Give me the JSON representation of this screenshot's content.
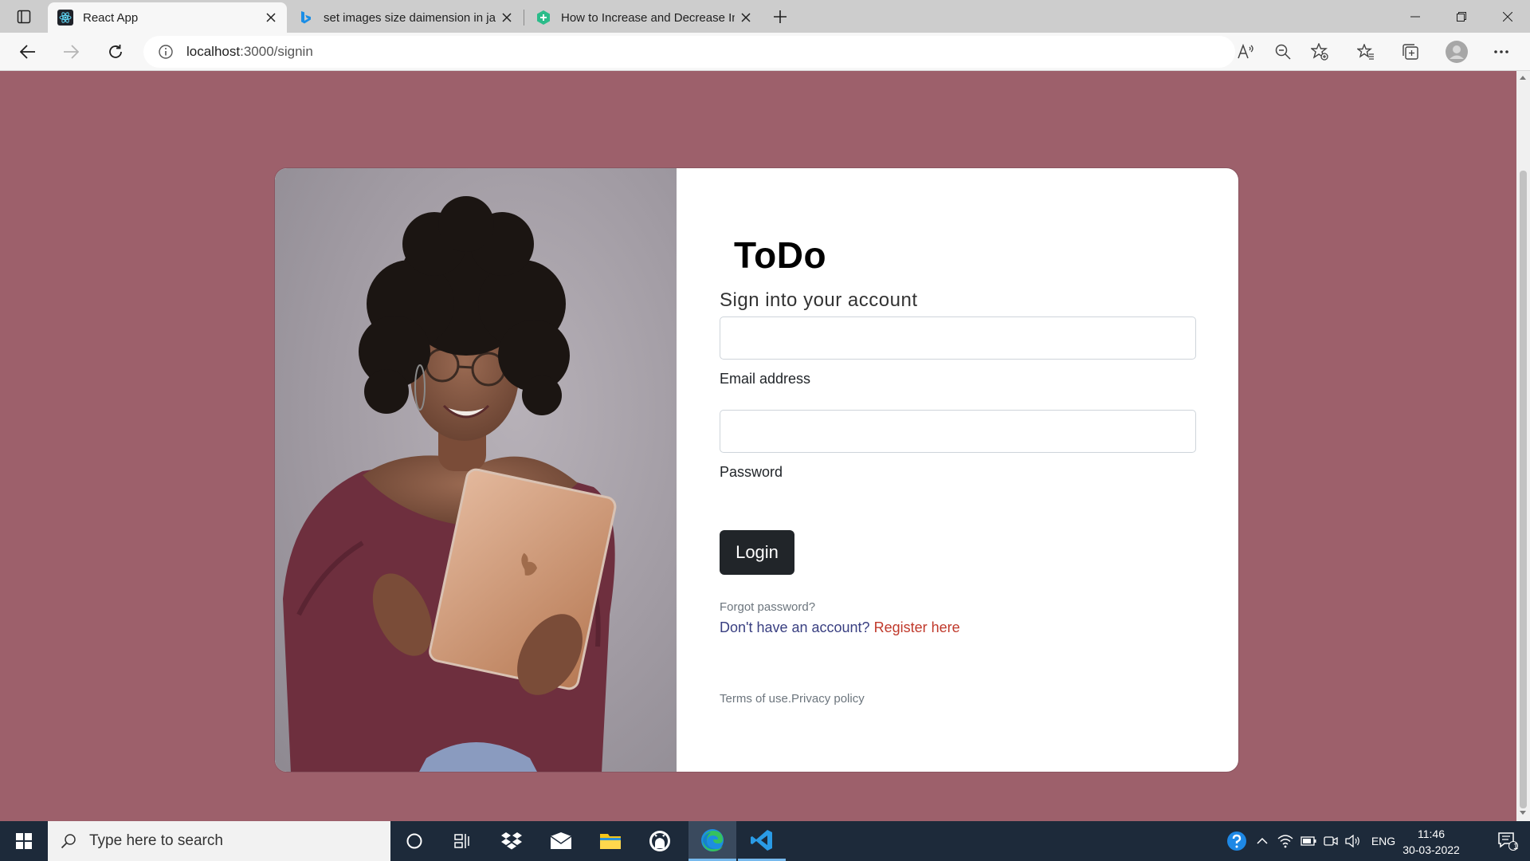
{
  "browser": {
    "tabs": [
      {
        "title": "React App",
        "favicon": "react-icon",
        "active": true
      },
      {
        "title": "set images size daimension in ja",
        "favicon": "bing-icon",
        "active": false
      },
      {
        "title": "How to Increase and Decrease In",
        "favicon": "geeks-icon",
        "active": false
      }
    ],
    "url_host": "localhost",
    "url_rest": ":3000/signin"
  },
  "page": {
    "brand": "ToDo",
    "subtitle": "Sign into your account",
    "email_label": "Email address",
    "password_label": "Password",
    "login_button": "Login",
    "forgot": "Forgot password?",
    "no_account": "Don't have an account? ",
    "register": "Register here",
    "terms": "Terms of use.",
    "privacy": "Privacy policy",
    "colors": {
      "background": "#9d606b",
      "button": "#212529",
      "register_link": "#c0392b"
    }
  },
  "taskbar": {
    "search_placeholder": "Type here to search",
    "language": "ENG",
    "time": "11:46",
    "date": "30-03-2022",
    "notification_count": "1"
  }
}
